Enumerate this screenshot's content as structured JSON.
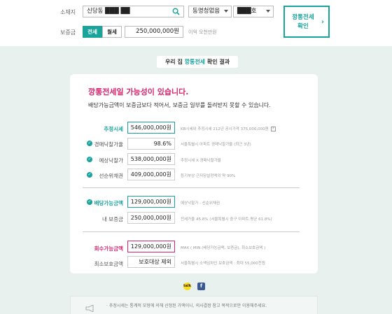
{
  "form": {
    "address_label": "소재지",
    "address_value": "신당동 ███ ██",
    "complex_value": "동명청없음",
    "unit_value": "███호",
    "deposit_label": "보증금",
    "tab_jeonse": "전세",
    "tab_wolse": "월세",
    "deposit_value": "250,000,000원",
    "deposit_hint": "이억 오천만원",
    "confirm_line1": "깡통전세",
    "confirm_line2": "확인"
  },
  "result": {
    "title_prefix": "우리 집 ",
    "title_highlight": "깡통전세",
    "title_suffix": " 확인 결과",
    "headline": "깡통전세일 가능성이 있습니다.",
    "subline": "배당가능금액이 보증금보다 적어서, 보증금 일부를 돌려받지 못할 수 있습니다.",
    "rows": [
      {
        "label": "추정시세",
        "value": "546,000,000원",
        "note": "KB시세와 추정시세 212년 공시가격 375,000,000원"
      },
      {
        "label": "경매낙찰가율",
        "value": "98.6%",
        "note": "서울특별시 아파트 경매낙찰가율 (최근 3년)"
      },
      {
        "label": "예상낙찰가",
        "value": "538,000,000원",
        "note": "추정시세 X 경매낙찰가율"
      },
      {
        "label": "선순위채권",
        "value": "409,000,000원",
        "note": "등기부상 근저당설정액의 약 90%"
      },
      {
        "label": "배당가능금액",
        "value": "129,000,000원",
        "note": "예상낙찰가 - 선순위채권"
      },
      {
        "label": "내 보증금",
        "value": "250,000,000원",
        "note": "전세가율 45.8% (서울특별시 중구 아파트 평균 61.8%)"
      },
      {
        "label": "회수가능금액",
        "value": "129,000,000원",
        "note": "MAX ( MIN (배당가능금액, 보증금), 최소보호금액 )"
      },
      {
        "label": "최소보호금액",
        "value": "보호대상 제외",
        "note": "서울특별시 소액임차인 보호금액 : 최대 55,000천원"
      }
    ]
  },
  "share": {
    "kakao": "talk",
    "facebook": "f"
  },
  "footer": {
    "note": "· 추정시세는 통계적 모형에 의해 산정된 가액이니, 의사결정 참고 목적으로만 이용해주세요."
  },
  "colors": {
    "accent": "#1aa39b",
    "alert": "#d6246e",
    "background": "#e8f1ee"
  },
  "icons": {
    "search": "search-icon",
    "check": "check-icon",
    "help": "question-icon",
    "megaphone": "megaphone-icon"
  }
}
